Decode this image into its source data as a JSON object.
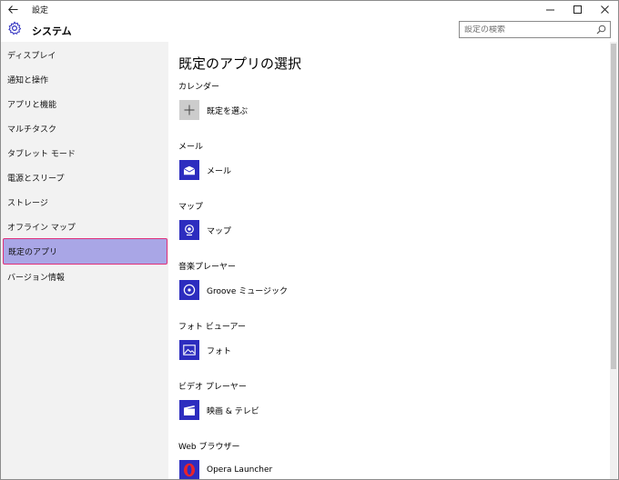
{
  "window": {
    "title": "設定",
    "back_icon": "arrow-left-icon",
    "controls": [
      "minimize-icon",
      "maximize-icon",
      "close-icon"
    ]
  },
  "header": {
    "title": "システム",
    "icon": "gear-icon"
  },
  "search": {
    "placeholder": "設定の検索",
    "value": ""
  },
  "sidebar": {
    "items": [
      {
        "label": "ディスプレイ",
        "active": false
      },
      {
        "label": "通知と操作",
        "active": false
      },
      {
        "label": "アプリと機能",
        "active": false
      },
      {
        "label": "マルチタスク",
        "active": false
      },
      {
        "label": "タブレット モード",
        "active": false
      },
      {
        "label": "電源とスリープ",
        "active": false
      },
      {
        "label": "ストレージ",
        "active": false
      },
      {
        "label": "オフライン マップ",
        "active": false
      },
      {
        "label": "既定のアプリ",
        "active": true
      },
      {
        "label": "バージョン情報",
        "active": false
      }
    ],
    "highlight_color": "#a9a6e6",
    "highlight_border": "#e0307a"
  },
  "main": {
    "title": "既定のアプリの選択",
    "sections": [
      {
        "label": "カレンダー",
        "app": "既定を選ぶ",
        "icon": "plus-icon"
      },
      {
        "label": "メール",
        "app": "メール",
        "icon": "mail-icon"
      },
      {
        "label": "マップ",
        "app": "マップ",
        "icon": "map-icon"
      },
      {
        "label": "音楽プレーヤー",
        "app": "Groove ミュージック",
        "icon": "music-disc-icon"
      },
      {
        "label": "フォト ビューアー",
        "app": "フォト",
        "icon": "photo-icon"
      },
      {
        "label": "ビデオ プレーヤー",
        "app": "映画 & テレビ",
        "icon": "clapper-icon"
      },
      {
        "label": "Web ブラウザー",
        "app": "Opera Launcher",
        "icon": "opera-icon"
      }
    ],
    "tile_color": "#2d2dbf"
  }
}
